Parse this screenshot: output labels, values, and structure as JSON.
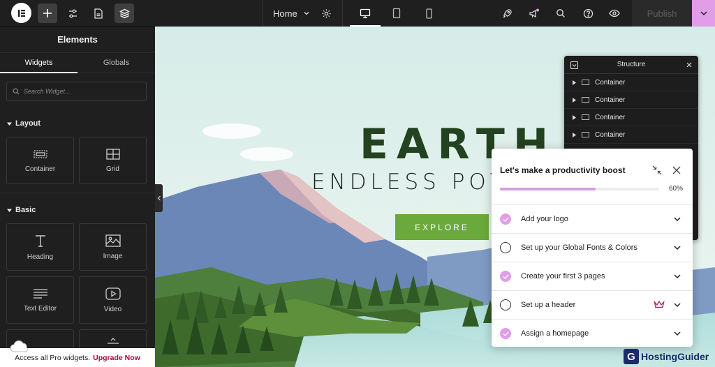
{
  "topbar": {
    "page_selector": "Home",
    "publish_label": "Publish"
  },
  "panel": {
    "title": "Elements",
    "tabs": [
      "Widgets",
      "Globals"
    ],
    "search_placeholder": "Search Widget...",
    "sections": [
      {
        "label": "Layout",
        "widgets": [
          {
            "label": "Container",
            "icon": "container-icon"
          },
          {
            "label": "Grid",
            "icon": "grid-icon"
          }
        ]
      },
      {
        "label": "Basic",
        "widgets": [
          {
            "label": "Heading",
            "icon": "heading-icon"
          },
          {
            "label": "Image",
            "icon": "image-icon"
          },
          {
            "label": "Text Editor",
            "icon": "text-editor-icon"
          },
          {
            "label": "Video",
            "icon": "video-icon"
          }
        ]
      }
    ],
    "pro_bar": {
      "text": "Access all Pro widgets.",
      "link": "Upgrade Now"
    }
  },
  "canvas": {
    "hero_title": "EARTH",
    "hero_subtitle": "ENDLESS POTE",
    "cta": "EXPLORE"
  },
  "structure": {
    "title": "Structure",
    "items": [
      "Container",
      "Container",
      "Container",
      "Container"
    ]
  },
  "checklist": {
    "title": "Let's make a productivity boost",
    "progress": 0.6,
    "progress_label": "60%",
    "items": [
      {
        "label": "Add your logo",
        "done": true
      },
      {
        "label": "Set up your Global Fonts & Colors",
        "done": false
      },
      {
        "label": "Create your first 3 pages",
        "done": true
      },
      {
        "label": "Set up a header",
        "done": false,
        "pro": true
      },
      {
        "label": "Assign a homepage",
        "done": true
      }
    ]
  },
  "watermark": "HostingGuider",
  "colors": {
    "accent": "#e29de8",
    "hero_green": "#23421f",
    "cta_green": "#6ba93c",
    "upgrade": "#b8003a"
  }
}
